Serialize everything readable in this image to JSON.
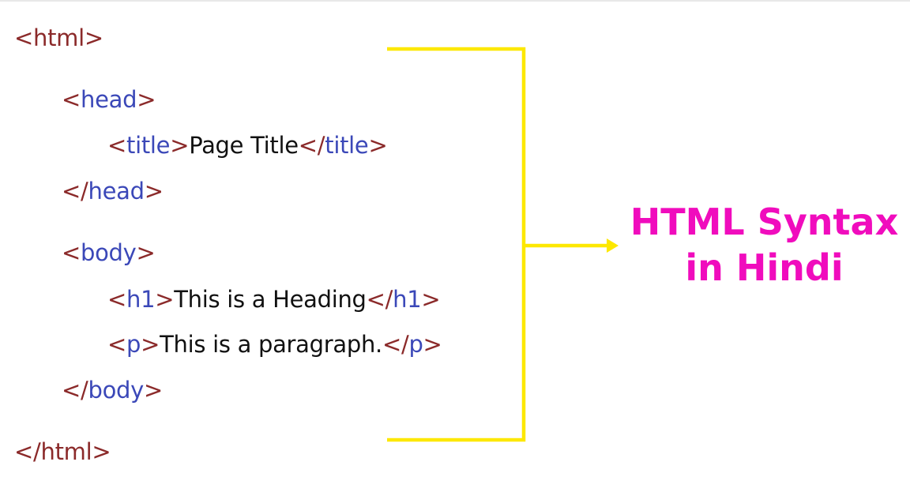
{
  "colors": {
    "bracket": "#8b2a2a",
    "tag_name": "#3b48b8",
    "text": "#111111",
    "connector": "#fde800",
    "label": "#f00cbd"
  },
  "code": {
    "html_open": {
      "open": "<",
      "name": "html",
      "close": ">"
    },
    "head_open": {
      "open": "<",
      "name": "head",
      "close": ">"
    },
    "title_line": {
      "open": "<",
      "name": "title",
      "close": ">",
      "text": "Page Title",
      "end_open": "</",
      "end_name": "title",
      "end_close": ">"
    },
    "head_close": {
      "open": "</",
      "name": "head",
      "close": ">"
    },
    "body_open": {
      "open": "<",
      "name": "body",
      "close": ">"
    },
    "h1_line": {
      "open": "<",
      "name": "h1",
      "close": ">",
      "text": "This is a Heading",
      "end_open": "</",
      "end_name": "h1",
      "end_close": ">"
    },
    "p_line": {
      "open": "<",
      "name": "p",
      "close": ">",
      "text": "This is a paragraph.",
      "end_open": "</",
      "end_name": "p",
      "end_close": ">"
    },
    "body_close": {
      "open": "</",
      "name": "body",
      "close": ">"
    },
    "html_close": {
      "open": "</",
      "name": "html",
      "close": ">"
    }
  },
  "label": {
    "line1": "HTML Syntax",
    "line2": "in Hindi"
  }
}
